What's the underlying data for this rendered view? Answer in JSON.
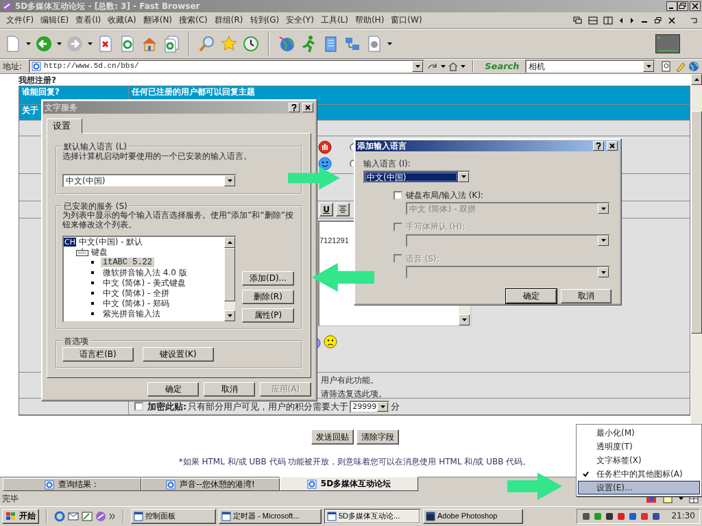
{
  "window": {
    "title": "5D多媒体互动论坛 - [总数: 3] - Fast Browser"
  },
  "menu": [
    "文件(F)",
    "编辑(E)",
    "查看(I)",
    "收藏(A)",
    "翻译(N)",
    "搜索(C)",
    "群组(R)",
    "转到(G)",
    "安全(Y)",
    "工具(L)",
    "帮助(H)",
    "窗口(W)"
  ],
  "address_bar": {
    "label": "地址:",
    "url": "http://www.5d.cn/bbs/"
  },
  "search_bar": {
    "label": "Search",
    "value": "相机"
  },
  "page": {
    "heading": "我想注册?",
    "reply_row": {
      "label": "谁能回复?",
      "value": "任何已注册的用户都可以回复主题"
    },
    "about_row": {
      "label": "关于"
    },
    "mood_options": [
      {
        "selected": false
      },
      {
        "selected": false
      }
    ],
    "editor_toolbar": [
      "U"
    ],
    "editor_text": "7121291",
    "notice_lines": [
      "用户有此功能。",
      "请筛选复选此项。"
    ],
    "encrypt": {
      "checked": false,
      "label": "加密此贴:",
      "text": "只有部分用户可见，用户的积分需要大于",
      "points": "29999",
      "unit": "分"
    },
    "buttons": [
      "发送回贴",
      "清除字段"
    ],
    "footnote": "*如果 HTML 和/或 UBB 代码 功能被开放，则意味着您可以在消息使用 HTML 和/或 UBB 代码。"
  },
  "page_tabs": [
    {
      "label": "查询结果：",
      "selected": false
    },
    {
      "label": "声音--您休憩的港湾!",
      "selected": false
    },
    {
      "label": "5D多媒体互动论坛",
      "selected": true
    }
  ],
  "status_bar": {
    "text": "完毕"
  },
  "taskbar": {
    "start": "开始",
    "tasks": [
      {
        "label": "控制面板",
        "selected": false
      },
      {
        "label": "定时器 - Microsoft...",
        "selected": false
      },
      {
        "label": "5D多媒体互动论...",
        "selected": true
      },
      {
        "label": "Adobe Photoshop",
        "selected": false
      }
    ],
    "clock": "21:30"
  },
  "text_services_dialog": {
    "title": "文字服务",
    "tabs": [
      {
        "label": "设置",
        "selected": true
      }
    ],
    "default_language": {
      "legend": "默认输入语言 (L)",
      "description": "选择计算机启动时要使用的一个已安装的输入语言。",
      "value": "中文(中国)"
    },
    "installed_services": {
      "legend": "已安装的服务 (S)",
      "description": "为列表中显示的每个输入语言选择服务。使用“添加”和“删除”按钮来修改这个列表。",
      "tree": [
        {
          "badge": "CH",
          "label": "中文(中国) - 默认",
          "children": [
            {
              "label": "键盘",
              "children": [
                {
                  "label": "itABC 5.22",
                  "selected": true
                },
                {
                  "label": "微软拼音输入法 4.0 版",
                  "selected": false
                },
                {
                  "label": "中文 (简体) - 美式键盘",
                  "selected": false
                },
                {
                  "label": "中文 (简体) - 全拼",
                  "selected": false
                },
                {
                  "label": "中文 (简体) - 郑码",
                  "selected": false
                },
                {
                  "label": "紫光拼音输入法",
                  "selected": false
                }
              ]
            }
          ]
        }
      ],
      "buttons": [
        "添加(D)...",
        "删除(R)",
        "属性(P)"
      ]
    },
    "preferences": {
      "legend": "首选项",
      "buttons": [
        "语言栏(B)",
        "键设置(K)"
      ]
    },
    "buttons": [
      {
        "label": "确定",
        "disabled": false
      },
      {
        "label": "取消",
        "disabled": false
      },
      {
        "label": "应用(A)",
        "disabled": true
      }
    ]
  },
  "add_language_dialog": {
    "title": "添加输入语言",
    "language_label": "输入语言 (I):",
    "language_value": "中文(中国)",
    "options": [
      {
        "label": "键盘布局/输入法 (K):",
        "checked": false,
        "disabled": false,
        "value": "中文 (简体) - 双拼"
      },
      {
        "label": "手写体辨认 (H):",
        "checked": false,
        "disabled": true
      },
      {
        "label": "语音 (S):",
        "checked": false,
        "disabled": true
      }
    ],
    "buttons": [
      {
        "label": "确定",
        "default": true
      },
      {
        "label": "取消",
        "default": false
      }
    ]
  },
  "context_menu": {
    "items": [
      {
        "label": "最小化(M)",
        "checked": false,
        "selected": false
      },
      {
        "label": "透明度(T)",
        "checked": false,
        "selected": false
      },
      {
        "label": "文字标签(X)",
        "checked": false,
        "selected": false
      },
      {
        "label": "任务栏中的其他图标(A)",
        "checked": true,
        "selected": false
      },
      {
        "label": "设置(E)...",
        "checked": false,
        "selected": true
      }
    ]
  }
}
